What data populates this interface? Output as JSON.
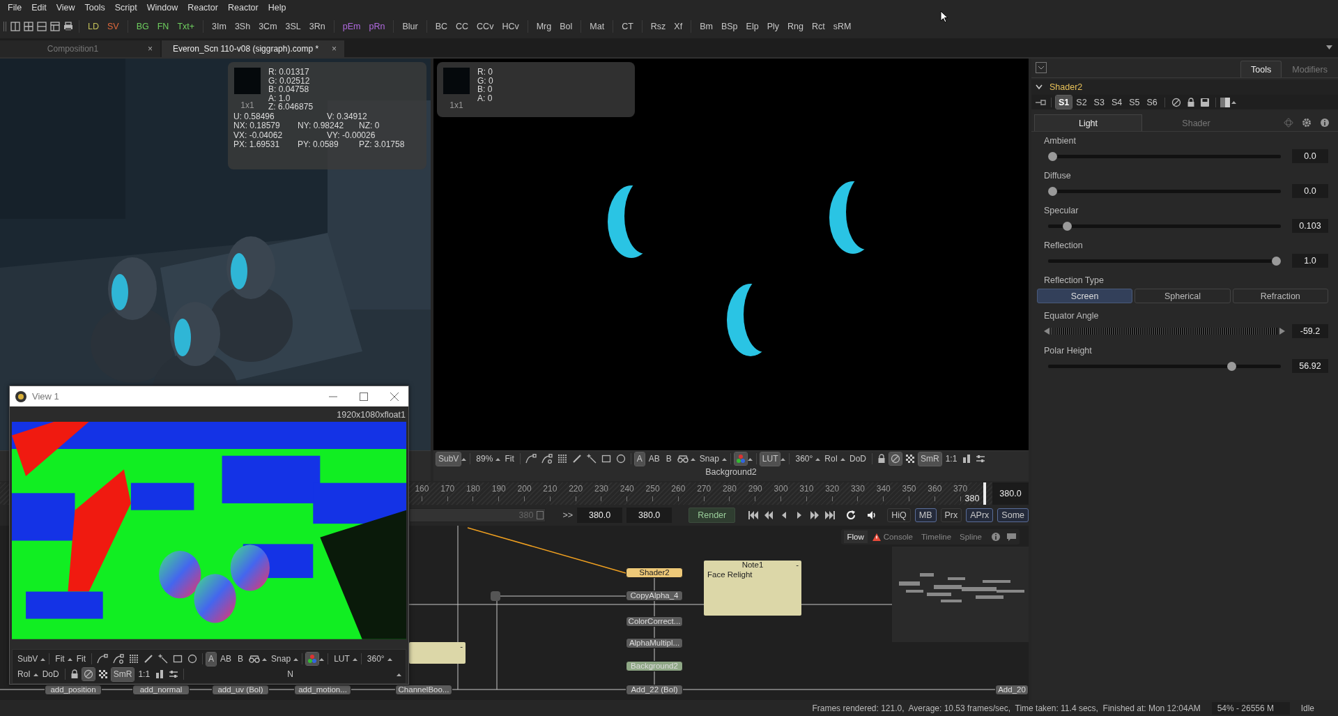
{
  "menu_bar": [
    "File",
    "Edit",
    "View",
    "Tools",
    "Script",
    "Window",
    "Reactor",
    "Reactor",
    "Help"
  ],
  "toolbar": [
    [
      {
        "label": "LD",
        "color": "#c4c25a"
      },
      {
        "label": "SV",
        "color": "#e0693c"
      }
    ],
    [
      {
        "label": "BG",
        "color": "#6fcf5f"
      },
      {
        "label": "FN",
        "color": "#6fcf5f"
      },
      {
        "label": "Txt+",
        "color": "#6fcf5f"
      }
    ],
    [
      {
        "label": "3Im",
        "color": "#c8c8c8"
      },
      {
        "label": "3Sh",
        "color": "#c8c8c8"
      },
      {
        "label": "3Cm",
        "color": "#c8c8c8"
      },
      {
        "label": "3SL",
        "color": "#c8c8c8"
      },
      {
        "label": "3Rn",
        "color": "#c8c8c8"
      }
    ],
    [
      {
        "label": "pEm",
        "color": "#b06adf"
      },
      {
        "label": "pRn",
        "color": "#b06adf"
      }
    ],
    [
      {
        "label": "Blur",
        "color": "#c8c8c8"
      }
    ],
    [
      {
        "label": "BC",
        "color": "#c8c8c8"
      },
      {
        "label": "CC",
        "color": "#c8c8c8"
      },
      {
        "label": "CCv",
        "color": "#c8c8c8"
      },
      {
        "label": "HCv",
        "color": "#c8c8c8"
      }
    ],
    [
      {
        "label": "Mrg",
        "color": "#c8c8c8"
      },
      {
        "label": "Bol",
        "color": "#c8c8c8"
      }
    ],
    [
      {
        "label": "Mat",
        "color": "#c8c8c8"
      }
    ],
    [
      {
        "label": "CT",
        "color": "#c8c8c8"
      }
    ],
    [
      {
        "label": "Rsz",
        "color": "#c8c8c8"
      },
      {
        "label": "Xf",
        "color": "#c8c8c8"
      }
    ],
    [
      {
        "label": "Bm",
        "color": "#c8c8c8"
      },
      {
        "label": "BSp",
        "color": "#c8c8c8"
      },
      {
        "label": "Elp",
        "color": "#c8c8c8"
      },
      {
        "label": "Ply",
        "color": "#c8c8c8"
      },
      {
        "label": "Rng",
        "color": "#c8c8c8"
      },
      {
        "label": "Rct",
        "color": "#c8c8c8"
      },
      {
        "label": "sRM",
        "color": "#c8c8c8"
      }
    ]
  ],
  "document_tabs": [
    {
      "label": "Composition1",
      "selected": false,
      "close": "×"
    },
    {
      "label": "Everon_Scn 110-v08 (siggraph).comp *",
      "selected": true,
      "close": "×"
    }
  ],
  "left_viewer": {
    "pixel_info": {
      "size": "1x1",
      "values": [
        "R: 0.01317",
        "G: 0.02512",
        "B: 0.04758",
        "A: 1.0",
        "Z: 6.046875"
      ],
      "rows": [
        [
          "U: 0.58496",
          "V: 0.34912"
        ],
        [
          "NX: 0.18579",
          "NY: 0.98242",
          "NZ: 0"
        ],
        [
          "VX: -0.04062",
          "VY: -0.00026"
        ],
        [
          "PX: 1.69531",
          "PY: 0.0589",
          "PZ: 3.01758"
        ]
      ]
    }
  },
  "right_viewer": {
    "pixel_info": {
      "size": "1x1",
      "values": [
        "R: 0",
        "G: 0",
        "B: 0",
        "A: 0"
      ]
    },
    "toolbar": [
      {
        "kind": "button",
        "label": "SubV",
        "selected": true,
        "menu": true
      },
      {
        "kind": "separator"
      },
      {
        "kind": "button",
        "label": "89%",
        "selected": false,
        "menu": true
      },
      {
        "kind": "button",
        "label": "Fit",
        "selected": false
      },
      {
        "kind": "separator"
      },
      {
        "kind": "icon",
        "selected": false
      },
      {
        "kind": "icon",
        "selected": false
      },
      {
        "kind": "icon",
        "selected": false
      },
      {
        "kind": "icon",
        "selected": false
      },
      {
        "kind": "icon",
        "selected": false
      },
      {
        "kind": "icon",
        "selected": false
      },
      {
        "kind": "icon",
        "selected": false
      },
      {
        "kind": "separator"
      },
      {
        "kind": "button",
        "label": "A",
        "selected": true
      },
      {
        "kind": "button",
        "label": "AB",
        "selected": false
      },
      {
        "kind": "button",
        "label": "B",
        "selected": false
      },
      {
        "kind": "icon",
        "selected": false,
        "menu": true
      },
      {
        "kind": "button",
        "label": "Snap",
        "selected": false,
        "menu": true
      },
      {
        "kind": "separator"
      },
      {
        "kind": "icon",
        "selected": true,
        "menu": true
      },
      {
        "kind": "separator"
      },
      {
        "kind": "button",
        "label": "LUT",
        "selected": true,
        "menu": true
      },
      {
        "kind": "separator"
      },
      {
        "kind": "button",
        "label": "360°",
        "selected": false,
        "menu": true
      },
      {
        "kind": "button",
        "label": "RoI",
        "selected": false,
        "menu": true
      },
      {
        "kind": "button",
        "label": "DoD",
        "selected": false
      },
      {
        "kind": "separator"
      },
      {
        "kind": "icon",
        "selected": false
      },
      {
        "kind": "icon",
        "selected": true
      },
      {
        "kind": "icon",
        "selected": false
      },
      {
        "kind": "button",
        "label": "SmR",
        "selected": true
      },
      {
        "kind": "button",
        "label": "1:1",
        "selected": false
      },
      {
        "kind": "icon",
        "selected": false
      },
      {
        "kind": "icon",
        "selected": false
      }
    ],
    "label": "Background2"
  },
  "timeline": {
    "ticks": [
      "160",
      "170",
      "180",
      "190",
      "200",
      "210",
      "220",
      "230",
      "240",
      "250",
      "260",
      "270",
      "280",
      "290",
      "300",
      "310",
      "320",
      "330",
      "340",
      "350",
      "360",
      "370"
    ],
    "current_frame": "380",
    "frame_field": "380.0"
  },
  "transport": {
    "range": {
      "end": "380",
      "level": 1
    },
    "jump": ">>",
    "fields": [
      "380.0",
      "380.0"
    ],
    "render": "Render",
    "toggles": [
      {
        "label": "HiQ",
        "selected": false
      },
      {
        "label": "MB",
        "selected": true
      },
      {
        "label": "Prx",
        "selected": false
      },
      {
        "label": "APrx",
        "selected": true
      },
      {
        "label": "Some",
        "selected": true
      }
    ]
  },
  "flow": {
    "tabs": [
      {
        "label": "Flow",
        "selected": true
      },
      {
        "label": "Console",
        "selected": false,
        "warning": true
      },
      {
        "label": "Timeline",
        "selected": false
      },
      {
        "label": "Spline",
        "selected": false
      }
    ],
    "nodes": [
      {
        "label": "Shader2",
        "color": "#edc878"
      },
      {
        "label": "CopyAlpha_4",
        "color": "#5c5c5c"
      },
      {
        "label": "ColorCorrect...",
        "color": "#5c5c5c"
      },
      {
        "label": "AlphaMultipl...",
        "color": "#5c5c5c"
      },
      {
        "label": "Background2",
        "color": "#8fa886"
      },
      {
        "label": "add_position",
        "color": "#5c5c5c"
      },
      {
        "label": "add_normal",
        "color": "#5c5c5c"
      },
      {
        "label": "add_uv  (Bol)",
        "color": "#5c5c5c"
      },
      {
        "label": "add_motion...",
        "color": "#5c5c5c"
      },
      {
        "label": "ChannelBoo...",
        "color": "#5c5c5c"
      },
      {
        "label": "Add_22  (Bol)",
        "color": "#5c5c5c"
      },
      {
        "label": "Add_20",
        "color": "#5c5c5c"
      }
    ],
    "notes": [
      {
        "title": "Note1",
        "text": "Face Relight",
        "collapse": "-"
      },
      {
        "collapse": "-"
      }
    ]
  },
  "inspector": {
    "tabs": [
      {
        "label": "Tools",
        "selected": true
      },
      {
        "label": "Modifiers",
        "selected": false
      }
    ],
    "tool": {
      "name": "Shader2",
      "expanded": true
    },
    "versions": [
      {
        "label": "S1",
        "selected": true
      },
      {
        "label": "S2",
        "selected": false
      },
      {
        "label": "S3",
        "selected": false
      },
      {
        "label": "S4",
        "selected": false
      },
      {
        "label": "S5",
        "selected": false
      },
      {
        "label": "S6",
        "selected": false
      }
    ],
    "subtabs": [
      {
        "label": "Light",
        "selected": true
      },
      {
        "label": "Shader",
        "selected": false
      }
    ],
    "controls": [
      {
        "kind": "slider",
        "label": "Ambient",
        "level": 0,
        "value": "0.0"
      },
      {
        "kind": "slider",
        "label": "Diffuse",
        "level": 0,
        "value": "0.0"
      },
      {
        "kind": "slider",
        "label": "Specular",
        "level": 0.066,
        "value": "0.103"
      },
      {
        "kind": "slider",
        "label": "Reflection",
        "level": 1,
        "value": "1.0"
      },
      {
        "kind": "choice",
        "label": "Reflection Type",
        "options": [
          {
            "label": "Screen",
            "selected": true
          },
          {
            "label": "Spherical",
            "selected": false
          },
          {
            "label": "Refraction",
            "selected": false
          }
        ]
      },
      {
        "kind": "wheel",
        "label": "Equator Angle",
        "value": "-59.2"
      },
      {
        "kind": "slider",
        "label": "Polar Height",
        "level": 0.8,
        "value": "56.92"
      }
    ]
  },
  "view_window": {
    "title": "View 1",
    "resolution": "1920x1080xfloat1",
    "toolbar_rows": [
      [
        {
          "kind": "button",
          "label": "SubV",
          "selected": false,
          "menu": true
        },
        {
          "kind": "separator"
        },
        {
          "kind": "button",
          "label": "Fit",
          "selected": false,
          "menu": true
        },
        {
          "kind": "button",
          "label": "Fit",
          "selected": false
        },
        {
          "kind": "separator"
        },
        {
          "kind": "icon",
          "selected": false
        },
        {
          "kind": "icon",
          "selected": false
        },
        {
          "kind": "icon",
          "selected": false
        },
        {
          "kind": "icon",
          "selected": false
        },
        {
          "kind": "icon",
          "selected": false
        },
        {
          "kind": "icon",
          "selected": false
        },
        {
          "kind": "icon",
          "selected": false
        },
        {
          "kind": "separator"
        },
        {
          "kind": "button",
          "label": "A",
          "selected": true
        },
        {
          "kind": "button",
          "label": "AB",
          "selected": false
        },
        {
          "kind": "button",
          "label": "B",
          "selected": false
        },
        {
          "kind": "icon",
          "selected": false,
          "menu": true
        },
        {
          "kind": "button",
          "label": "Snap",
          "selected": false,
          "menu": true
        },
        {
          "kind": "separator"
        },
        {
          "kind": "icon",
          "selected": true,
          "menu": true
        },
        {
          "kind": "separator"
        },
        {
          "kind": "button",
          "label": "LUT",
          "selected": false,
          "menu": true
        },
        {
          "kind": "separator"
        },
        {
          "kind": "button",
          "label": "360°",
          "selected": false,
          "menu": true
        }
      ],
      [
        {
          "kind": "button",
          "label": "RoI",
          "selected": false,
          "menu": true
        },
        {
          "kind": "button",
          "label": "DoD",
          "selected": false
        },
        {
          "kind": "separator"
        },
        {
          "kind": "icon",
          "selected": false
        },
        {
          "kind": "icon",
          "selected": true
        },
        {
          "kind": "icon",
          "selected": false
        },
        {
          "kind": "button",
          "label": "SmR",
          "selected": true
        },
        {
          "kind": "button",
          "label": "1:1",
          "selected": false
        },
        {
          "kind": "icon",
          "selected": false
        },
        {
          "kind": "icon",
          "selected": false
        },
        {
          "kind": "separator"
        },
        {
          "kind": "label",
          "label": "N"
        },
        {
          "kind": "icon",
          "selected": false
        }
      ]
    ]
  },
  "status_bar": {
    "message": "Frames rendered: 121.0,  Average: 10.53 frames/sec,  Time taken: 11.4 secs,  Finished at: Mon 12:04AM",
    "memory": "54% - 26556 M",
    "state": "Idle"
  }
}
